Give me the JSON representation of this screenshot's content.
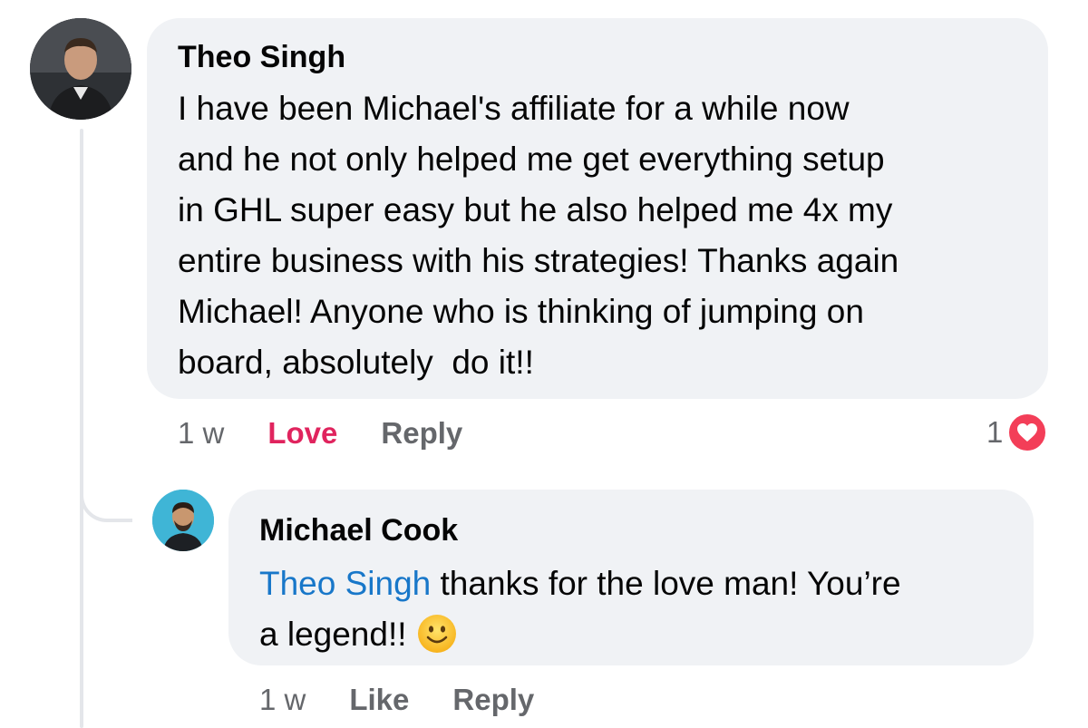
{
  "comment": {
    "author": "Theo Singh",
    "text": "I have been Michael's affiliate for a while now\nand he not only helped me get everything setup\nin GHL super easy but he also helped me 4x my\nentire business with his strategies! Thanks again\nMichael! Anyone who is thinking of jumping on\nboard, absolutely  do it!!",
    "time": "1 w",
    "reaction_label": "Love",
    "reply_label": "Reply",
    "reaction_count": "1",
    "reaction_icon": "heart-icon",
    "reaction_color": "#f33e58"
  },
  "reply": {
    "author": "Michael Cook",
    "mention": "Theo Singh",
    "text_after_mention": " thanks for the love man! You’re\na legend!!",
    "emoji": "slightly-smiling-face-icon",
    "time": "1 w",
    "like_label": "Like",
    "reply_label": "Reply"
  },
  "colors": {
    "bubble_bg": "#f0f2f5",
    "love": "#e0245e",
    "mention": "#1877c9",
    "meta": "#65676b"
  }
}
